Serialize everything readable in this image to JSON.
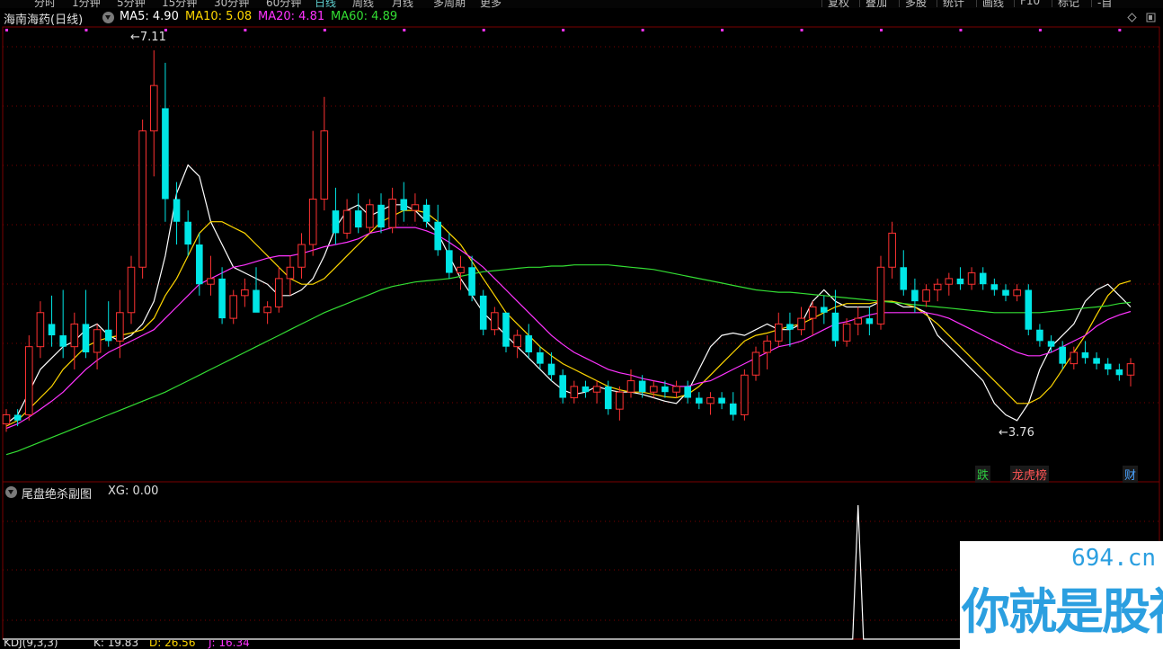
{
  "topbar": {
    "tabs": [
      "分时",
      "1分钟",
      "5分钟",
      "15分钟",
      "30分钟",
      "60分钟",
      "日线",
      "周线",
      "月线",
      "多周期",
      "更多"
    ],
    "active_tab": "日线",
    "right_tabs": [
      "复权",
      "叠加",
      "多股",
      "统计",
      "画线",
      "F10",
      "标记",
      "-自"
    ]
  },
  "main_header": {
    "stock_name": "海南海药(日线)",
    "ma": [
      {
        "label": "MA5: 4.90",
        "color": "#ffffff"
      },
      {
        "label": "MA10: 5.08",
        "color": "#ffd700"
      },
      {
        "label": "MA20: 4.81",
        "color": "#ff33ff"
      },
      {
        "label": "MA60: 4.89",
        "color": "#33dd33"
      }
    ]
  },
  "annotations": {
    "high_label": "7.11",
    "low_label": "3.76"
  },
  "badges": [
    {
      "text": "跌",
      "color": "#2ecc40"
    },
    {
      "text": "龙虎榜",
      "color": "#ff5555"
    },
    {
      "text": "财",
      "color": "#4aa3ff"
    }
  ],
  "sub_header": {
    "title": "尾盘绝杀副图",
    "value": "XG: 0.00"
  },
  "bottom_bar": {
    "indicator": "KDJ(9,3,3)",
    "k": "K: 19.83",
    "d": "D: 26.56",
    "j": "J: 16.34"
  },
  "watermark": {
    "site": "694.cn",
    "slogan": "你就是股神"
  },
  "colors": {
    "up": "#ff3232",
    "down": "#00e6e6",
    "ma5": "#ffffff",
    "ma10": "#ffd700",
    "ma20": "#ff33ff",
    "ma60": "#33dd33",
    "grid": "#7a0000"
  },
  "chart_data": [
    {
      "type": "candlestick",
      "title": "海南海药(日线)",
      "ylim": [
        3.5,
        7.3
      ],
      "series": [
        {
          "name": "MA5",
          "values": [
            3.82,
            3.9,
            4.1,
            4.3,
            4.4,
            4.5,
            4.55,
            4.65,
            4.7,
            4.6,
            4.55,
            4.6,
            4.7,
            4.9,
            5.3,
            5.85,
            6.1,
            6.0,
            5.6,
            5.4,
            5.2,
            5.15,
            5.1,
            5.05,
            4.95,
            4.95,
            5.0,
            5.1,
            5.3,
            5.55,
            5.7,
            5.75,
            5.65,
            5.7,
            5.75,
            5.75,
            5.7,
            5.6,
            5.5,
            5.3,
            5.1,
            4.95,
            4.8,
            4.7,
            4.6,
            4.5,
            4.4,
            4.3,
            4.2,
            4.12,
            4.08,
            4.1,
            4.15,
            4.12,
            4.1,
            4.1,
            4.08,
            4.05,
            4.02,
            4.0,
            4.1,
            4.3,
            4.5,
            4.6,
            4.62,
            4.6,
            4.65,
            4.7,
            4.65,
            4.65,
            4.7,
            4.9,
            5.0,
            4.9,
            4.85,
            4.85,
            4.85,
            4.9,
            4.9,
            4.85,
            4.85,
            4.8,
            4.6,
            4.5,
            4.4,
            4.3,
            4.2,
            4.0,
            3.9,
            3.85,
            4.0,
            4.3,
            4.5,
            4.6,
            4.7,
            4.9,
            5.0,
            5.05,
            4.95,
            4.85
          ]
        },
        {
          "name": "MA10",
          "values": [
            3.8,
            3.85,
            3.95,
            4.05,
            4.15,
            4.3,
            4.4,
            4.5,
            4.55,
            4.58,
            4.6,
            4.62,
            4.65,
            4.75,
            4.95,
            5.1,
            5.3,
            5.5,
            5.6,
            5.6,
            5.55,
            5.5,
            5.4,
            5.3,
            5.2,
            5.1,
            5.05,
            5.05,
            5.1,
            5.2,
            5.3,
            5.4,
            5.5,
            5.6,
            5.65,
            5.7,
            5.7,
            5.68,
            5.6,
            5.5,
            5.4,
            5.25,
            5.1,
            4.95,
            4.8,
            4.7,
            4.6,
            4.5,
            4.42,
            4.35,
            4.3,
            4.25,
            4.2,
            4.15,
            4.12,
            4.1,
            4.1,
            4.08,
            4.06,
            4.05,
            4.08,
            4.15,
            4.25,
            4.35,
            4.45,
            4.55,
            4.6,
            4.62,
            4.65,
            4.68,
            4.7,
            4.75,
            4.8,
            4.85,
            4.88,
            4.88,
            4.88,
            4.9,
            4.9,
            4.88,
            4.85,
            4.78,
            4.7,
            4.6,
            4.5,
            4.4,
            4.3,
            4.2,
            4.1,
            4.0,
            4.0,
            4.05,
            4.15,
            4.3,
            4.45,
            4.6,
            4.78,
            4.95,
            5.05,
            5.08
          ]
        },
        {
          "name": "MA20",
          "values": [
            3.78,
            3.82,
            3.88,
            3.95,
            4.02,
            4.1,
            4.2,
            4.3,
            4.38,
            4.45,
            4.5,
            4.55,
            4.6,
            4.65,
            4.75,
            4.85,
            4.95,
            5.05,
            5.1,
            5.15,
            5.2,
            5.22,
            5.25,
            5.28,
            5.3,
            5.3,
            5.32,
            5.35,
            5.38,
            5.4,
            5.42,
            5.45,
            5.5,
            5.52,
            5.55,
            5.55,
            5.55,
            5.52,
            5.48,
            5.42,
            5.35,
            5.28,
            5.2,
            5.1,
            5.0,
            4.9,
            4.8,
            4.7,
            4.6,
            4.52,
            4.45,
            4.4,
            4.35,
            4.3,
            4.27,
            4.25,
            4.22,
            4.2,
            4.18,
            4.15,
            4.15,
            4.18,
            4.2,
            4.25,
            4.3,
            4.35,
            4.4,
            4.45,
            4.5,
            4.52,
            4.55,
            4.6,
            4.65,
            4.7,
            4.72,
            4.75,
            4.78,
            4.8,
            4.8,
            4.8,
            4.8,
            4.8,
            4.78,
            4.75,
            4.7,
            4.65,
            4.6,
            4.55,
            4.5,
            4.45,
            4.42,
            4.42,
            4.45,
            4.5,
            4.55,
            4.6,
            4.68,
            4.74,
            4.78,
            4.81
          ]
        },
        {
          "name": "MA60",
          "values": [
            3.55,
            3.58,
            3.62,
            3.66,
            3.7,
            3.74,
            3.78,
            3.82,
            3.86,
            3.9,
            3.94,
            3.98,
            4.02,
            4.06,
            4.1,
            4.15,
            4.2,
            4.25,
            4.3,
            4.35,
            4.4,
            4.45,
            4.5,
            4.55,
            4.6,
            4.65,
            4.7,
            4.75,
            4.8,
            4.84,
            4.88,
            4.92,
            4.96,
            5.0,
            5.03,
            5.05,
            5.07,
            5.08,
            5.09,
            5.1,
            5.12,
            5.14,
            5.16,
            5.17,
            5.18,
            5.19,
            5.2,
            5.2,
            5.21,
            5.21,
            5.22,
            5.22,
            5.22,
            5.22,
            5.21,
            5.2,
            5.19,
            5.18,
            5.16,
            5.14,
            5.12,
            5.1,
            5.08,
            5.06,
            5.04,
            5.02,
            5.0,
            4.99,
            4.98,
            4.98,
            4.97,
            4.96,
            4.95,
            4.94,
            4.93,
            4.92,
            4.91,
            4.9,
            4.89,
            4.88,
            4.87,
            4.86,
            4.85,
            4.84,
            4.83,
            4.82,
            4.81,
            4.8,
            4.8,
            4.8,
            4.8,
            4.8,
            4.81,
            4.82,
            4.83,
            4.84,
            4.85,
            4.86,
            4.88,
            4.89
          ]
        }
      ],
      "ohlc": [
        [
          3.82,
          3.95,
          3.75,
          3.9
        ],
        [
          3.9,
          3.95,
          3.8,
          3.85
        ],
        [
          3.9,
          4.6,
          3.85,
          4.5
        ],
        [
          4.5,
          4.9,
          4.4,
          4.8
        ],
        [
          4.7,
          4.95,
          4.5,
          4.6
        ],
        [
          4.6,
          5.0,
          4.4,
          4.5
        ],
        [
          4.5,
          4.8,
          4.3,
          4.7
        ],
        [
          4.7,
          5.0,
          4.4,
          4.45
        ],
        [
          4.45,
          4.7,
          4.3,
          4.65
        ],
        [
          4.65,
          4.9,
          4.5,
          4.55
        ],
        [
          4.55,
          5.0,
          4.4,
          4.8
        ],
        [
          4.8,
          5.3,
          4.7,
          5.2
        ],
        [
          5.2,
          6.5,
          5.1,
          6.4
        ],
        [
          6.4,
          7.11,
          6.0,
          6.8
        ],
        [
          6.6,
          7.0,
          5.6,
          5.8
        ],
        [
          5.8,
          5.95,
          5.4,
          5.6
        ],
        [
          5.6,
          5.7,
          5.3,
          5.4
        ],
        [
          5.4,
          5.5,
          4.95,
          5.05
        ],
        [
          5.05,
          5.3,
          4.95,
          5.1
        ],
        [
          5.1,
          5.2,
          4.7,
          4.75
        ],
        [
          4.75,
          5.0,
          4.7,
          4.95
        ],
        [
          4.95,
          5.1,
          4.85,
          5.0
        ],
        [
          5.0,
          5.2,
          4.9,
          4.8
        ],
        [
          4.8,
          4.9,
          4.7,
          4.85
        ],
        [
          4.85,
          5.2,
          4.8,
          5.1
        ],
        [
          5.1,
          5.3,
          4.95,
          5.2
        ],
        [
          5.2,
          5.5,
          5.1,
          5.4
        ],
        [
          5.4,
          6.4,
          5.3,
          5.8
        ],
        [
          5.8,
          6.7,
          5.7,
          6.4
        ],
        [
          5.7,
          5.9,
          5.4,
          5.5
        ],
        [
          5.5,
          5.8,
          5.45,
          5.7
        ],
        [
          5.7,
          5.85,
          5.5,
          5.55
        ],
        [
          5.55,
          5.8,
          5.5,
          5.75
        ],
        [
          5.75,
          5.85,
          5.5,
          5.55
        ],
        [
          5.55,
          5.9,
          5.5,
          5.8
        ],
        [
          5.8,
          5.95,
          5.6,
          5.7
        ],
        [
          5.7,
          5.85,
          5.6,
          5.75
        ],
        [
          5.75,
          5.8,
          5.55,
          5.6
        ],
        [
          5.6,
          5.75,
          5.3,
          5.35
        ],
        [
          5.35,
          5.5,
          5.1,
          5.15
        ],
        [
          5.15,
          5.3,
          5.0,
          5.2
        ],
        [
          5.2,
          5.3,
          4.9,
          4.95
        ],
        [
          4.95,
          5.0,
          4.6,
          4.65
        ],
        [
          4.65,
          4.85,
          4.6,
          4.8
        ],
        [
          4.8,
          4.8,
          4.45,
          4.5
        ],
        [
          4.5,
          4.65,
          4.4,
          4.6
        ],
        [
          4.6,
          4.7,
          4.4,
          4.45
        ],
        [
          4.45,
          4.5,
          4.3,
          4.35
        ],
        [
          4.35,
          4.45,
          4.2,
          4.25
        ],
        [
          4.25,
          4.3,
          4.0,
          4.05
        ],
        [
          4.05,
          4.2,
          4.0,
          4.15
        ],
        [
          4.15,
          4.2,
          4.05,
          4.1
        ],
        [
          4.1,
          4.2,
          4.0,
          4.15
        ],
        [
          4.15,
          4.2,
          3.9,
          3.95
        ],
        [
          3.95,
          4.15,
          3.85,
          4.1
        ],
        [
          4.1,
          4.3,
          4.05,
          4.2
        ],
        [
          4.2,
          4.25,
          4.05,
          4.1
        ],
        [
          4.1,
          4.2,
          4.05,
          4.15
        ],
        [
          4.15,
          4.2,
          4.05,
          4.1
        ],
        [
          4.1,
          4.2,
          4.05,
          4.15
        ],
        [
          4.15,
          4.2,
          4.0,
          4.05
        ],
        [
          4.05,
          4.1,
          3.95,
          4.0
        ],
        [
          4.0,
          4.1,
          3.9,
          4.05
        ],
        [
          4.05,
          4.1,
          3.95,
          4.0
        ],
        [
          4.0,
          4.1,
          3.85,
          3.9
        ],
        [
          3.9,
          4.3,
          3.85,
          4.25
        ],
        [
          4.25,
          4.5,
          4.2,
          4.45
        ],
        [
          4.45,
          4.6,
          4.3,
          4.55
        ],
        [
          4.55,
          4.8,
          4.5,
          4.7
        ],
        [
          4.7,
          4.8,
          4.5,
          4.65
        ],
        [
          4.65,
          4.85,
          4.6,
          4.75
        ],
        [
          4.75,
          4.9,
          4.6,
          4.85
        ],
        [
          4.85,
          4.95,
          4.7,
          4.8
        ],
        [
          4.8,
          5.0,
          4.5,
          4.55
        ],
        [
          4.55,
          4.75,
          4.5,
          4.7
        ],
        [
          4.7,
          4.85,
          4.6,
          4.75
        ],
        [
          4.75,
          4.85,
          4.6,
          4.7
        ],
        [
          4.7,
          5.3,
          4.65,
          5.2
        ],
        [
          5.2,
          5.6,
          5.1,
          5.5
        ],
        [
          5.2,
          5.35,
          4.95,
          5.0
        ],
        [
          5.0,
          5.1,
          4.8,
          4.9
        ],
        [
          4.9,
          5.05,
          4.85,
          5.0
        ],
        [
          5.0,
          5.1,
          4.9,
          5.05
        ],
        [
          5.05,
          5.15,
          4.95,
          5.1
        ],
        [
          5.1,
          5.2,
          5.0,
          5.05
        ],
        [
          5.05,
          5.2,
          5.0,
          5.15
        ],
        [
          5.15,
          5.2,
          5.0,
          5.05
        ],
        [
          5.05,
          5.1,
          4.95,
          5.0
        ],
        [
          5.0,
          5.05,
          4.9,
          4.95
        ],
        [
          4.95,
          5.05,
          4.9,
          5.0
        ],
        [
          5.0,
          5.05,
          4.6,
          4.65
        ],
        [
          4.65,
          4.7,
          4.5,
          4.55
        ],
        [
          4.55,
          4.6,
          4.45,
          4.5
        ],
        [
          4.5,
          4.55,
          4.3,
          4.35
        ],
        [
          4.35,
          4.5,
          4.3,
          4.45
        ],
        [
          4.45,
          4.55,
          4.35,
          4.4
        ],
        [
          4.4,
          4.45,
          4.3,
          4.35
        ],
        [
          4.35,
          4.4,
          4.25,
          4.3
        ],
        [
          4.3,
          4.35,
          4.2,
          4.25
        ],
        [
          4.25,
          4.4,
          4.15,
          4.35
        ]
      ]
    },
    {
      "type": "line",
      "title": "尾盘绝杀副图",
      "ylim": [
        0,
        1
      ],
      "series": [
        {
          "name": "XG",
          "spike_index": 75,
          "values_note_index": 75
        }
      ]
    }
  ]
}
